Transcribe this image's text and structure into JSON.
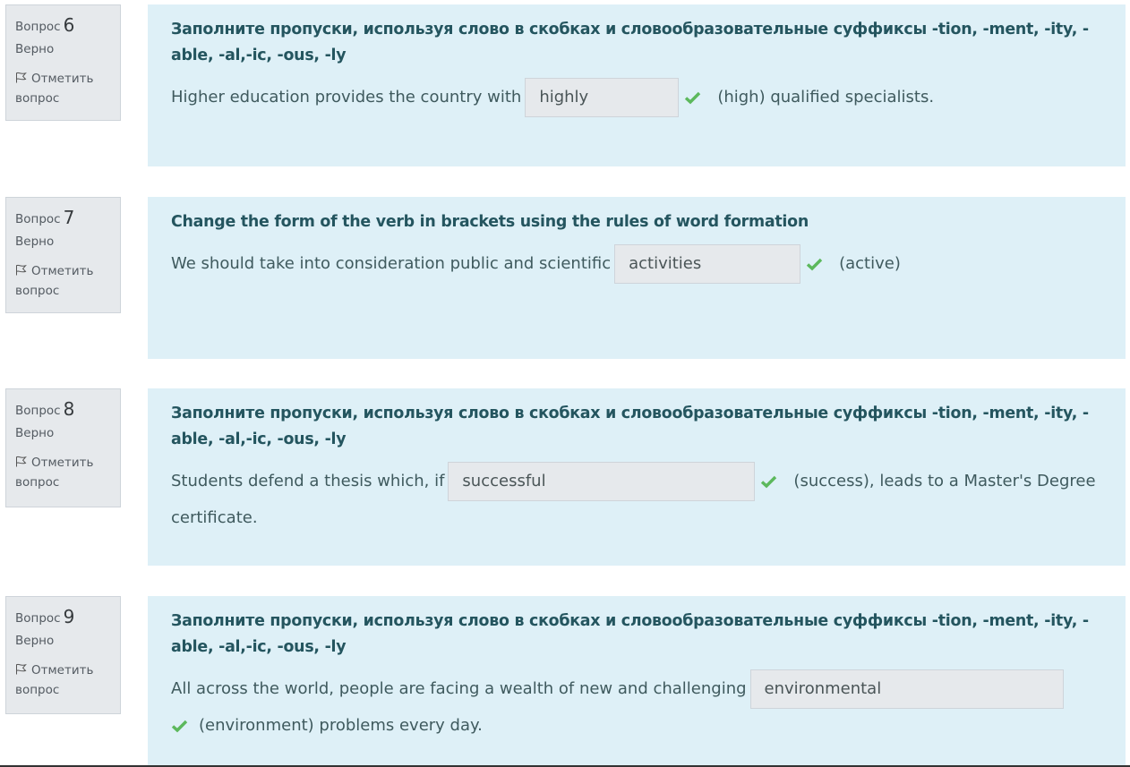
{
  "colors": {
    "accent": "#24555f",
    "correct": "#5cb85c",
    "panel": "#def0f7",
    "info": "#e6e9ec"
  },
  "questions": [
    {
      "label": "Вопрос",
      "number": "6",
      "state": "Верно",
      "flag_label": "Отметить вопрос",
      "prompt": "Заполните пропуски, используя слово в скобках и словообразовательные суффиксы -tion, -ment, -ity, -able, -al,-ic, -ous, -ly",
      "before": "Higher education provides the country with",
      "answer": "highly",
      "after": "(high) qualified specialists."
    },
    {
      "label": "Вопрос",
      "number": "7",
      "state": "Верно",
      "flag_label": "Отметить вопрос",
      "prompt": "Change the form of the verb in brackets using the rules of word formation",
      "before": "We should take into consideration public and scientific",
      "answer": "activities",
      "after": "(active)"
    },
    {
      "label": "Вопрос",
      "number": "8",
      "state": "Верно",
      "flag_label": "Отметить вопрос",
      "prompt": "Заполните пропуски, используя слово в скобках и словообразовательные суффиксы -tion, -ment, -ity, -able, -al,-ic, -ous, -ly",
      "before": "Students defend a thesis which, if",
      "answer": "successful",
      "after": "(success), leads to a Master's Degree certificate."
    },
    {
      "label": "Вопрос",
      "number": "9",
      "state": "Верно",
      "flag_label": "Отметить вопрос",
      "prompt": "Заполните пропуски, используя слово в скобках и словообразовательные суффиксы -tion, -ment, -ity, -able, -al,-ic, -ous, -ly",
      "before": "All across the world, people are facing a wealth of new and challenging",
      "answer": "environmental",
      "after": "(environment) problems every day."
    }
  ]
}
